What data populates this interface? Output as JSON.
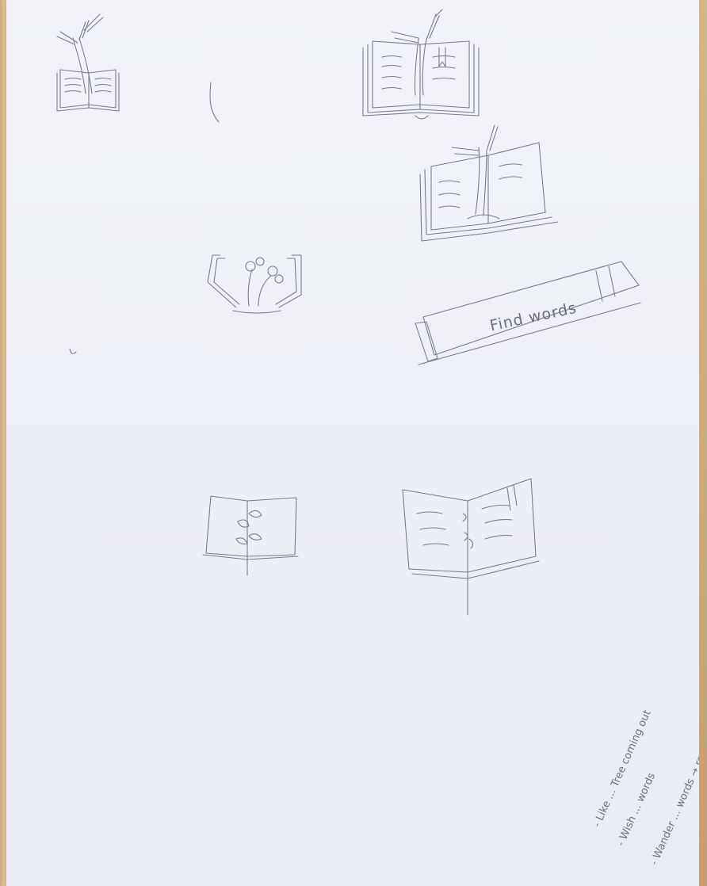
{
  "button_text": "Find words",
  "notes": [
    "- Like ... Tree coming out",
    "- Wish ... words",
    "- Wander ... words → roots"
  ]
}
